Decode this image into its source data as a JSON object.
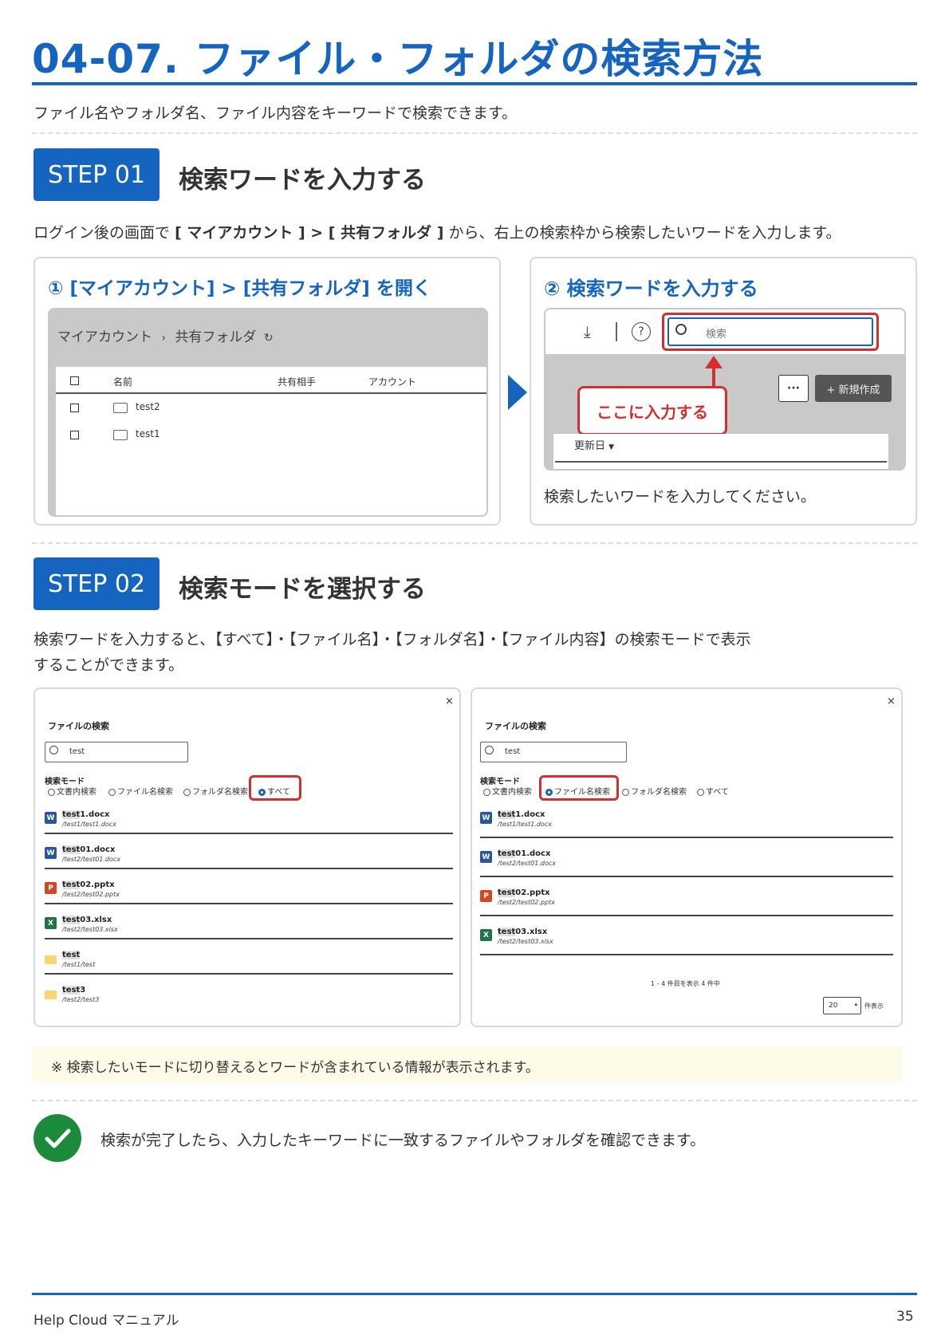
{
  "header": {
    "title": "04-07. ファイル・フォルダの検索方法",
    "intro": "ファイル名やフォルダ名、ファイル内容をキーワードで検索できます。"
  },
  "step1": {
    "badge": "STEP 01",
    "title": "検索ワードを入力する",
    "desc_prefix": "ログイン後の画面で",
    "desc_path": "[ マイアカウント ] > [ 共有フォルダ ]",
    "desc_suffix": "から、右上の検索枠から検索したいワードを入力します。",
    "panel1": {
      "heading": "① [マイアカウント] > [共有フォルダ] を開く",
      "breadcrumb_root": "マイアカウント",
      "breadcrumb_sep": "›",
      "breadcrumb_current": "共有フォルダ",
      "columns": [
        "名前",
        "共有相手",
        "アカウント"
      ],
      "rows": [
        "test2",
        "test1"
      ]
    },
    "panel2": {
      "heading": "② 検索ワードを入力する",
      "search_placeholder": "検索",
      "more_label": "···",
      "new_button": "+ 新規作成",
      "callout": "ここに入力する",
      "sort_label": "更新日",
      "caption": "検索したいワードを入力してください。"
    }
  },
  "step2": {
    "badge": "STEP 02",
    "title": "検索モードを選択する",
    "desc_line1": "検索ワードを入力すると、【すべて】・【ファイル名】・【フォルダ名】・【ファイル内容】の検索モードで表示",
    "desc_line2": "することができます。",
    "dialog_title": "ファイルの検索",
    "search_value": "test",
    "mode_label": "検索モード",
    "modes": [
      "文書内検索",
      "ファイル名検索",
      "フォルダ名検索",
      "すべて"
    ],
    "close": "×",
    "left_results": [
      {
        "hl": "test",
        "rest": "1.docx",
        "path": "/test1/test1.docx",
        "type": "W"
      },
      {
        "hl": "test",
        "rest": "01.docx",
        "path": "/test2/test01.docx",
        "type": "W"
      },
      {
        "hl": "test",
        "rest": "02.pptx",
        "path": "/test2/test02.pptx",
        "type": "P"
      },
      {
        "hl": "test",
        "rest": "03.xlsx",
        "path": "/test2/test03.xlsx",
        "type": "X"
      },
      {
        "hl": "test",
        "rest": "",
        "path": "/test1/test",
        "type": "F"
      },
      {
        "hl": "test",
        "rest": "3",
        "path": "/test2/test3",
        "type": "F"
      }
    ],
    "right_results": [
      {
        "hl": "test",
        "rest": "1.docx",
        "path": "/test1/test1.docx",
        "type": "W"
      },
      {
        "hl": "test",
        "rest": "01.docx",
        "path": "/test2/test01.docx",
        "type": "W"
      },
      {
        "hl": "test",
        "rest": "02.pptx",
        "path": "/test2/test02.pptx",
        "type": "P"
      },
      {
        "hl": "test",
        "rest": "03.xlsx",
        "path": "/test2/test03.xlsx",
        "type": "X"
      }
    ],
    "pagination": "1 - 4 件目を表示 4 件中",
    "per_page_value": "20",
    "per_page_label": "件表示"
  },
  "note": "※ 検索したいモードに切り替えるとワードが含まれている情報が表示されます。",
  "done": "検索が完了したら、入力したキーワードに一致するファイルやフォルダを確認できます。",
  "footer": {
    "left": "Help Cloud マニュアル",
    "page": "35"
  },
  "colors": {
    "brand": "#1565c0",
    "alert": "#d32f2f",
    "success": "#1b8a3a"
  }
}
